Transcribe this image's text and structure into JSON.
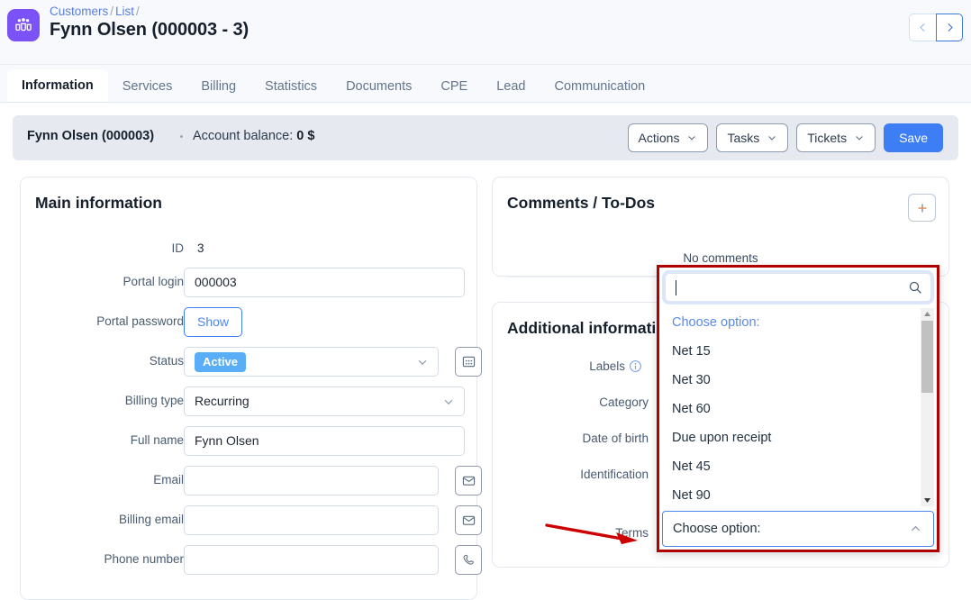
{
  "header": {
    "logo_icon": "people-group-icon",
    "breadcrumb": [
      "Customers",
      "List"
    ],
    "breadcrumb_sep": "/",
    "title": "Fynn Olsen (000003 - 3)",
    "nav_prev_icon": "chevron-left-icon",
    "nav_next_icon": "chevron-right-icon",
    "accent": "#7b52f5"
  },
  "tabs": [
    {
      "label": "Information",
      "active": true
    },
    {
      "label": "Services",
      "active": false
    },
    {
      "label": "Billing",
      "active": false
    },
    {
      "label": "Statistics",
      "active": false
    },
    {
      "label": "Documents",
      "active": false
    },
    {
      "label": "CPE",
      "active": false
    },
    {
      "label": "Lead",
      "active": false
    },
    {
      "label": "Communication",
      "active": false
    }
  ],
  "subbar": {
    "customer": "Fynn Olsen (000003)",
    "balance_label": "Account balance:",
    "balance_value": "0 $",
    "actions_label": "Actions",
    "tasks_label": "Tasks",
    "tickets_label": "Tickets",
    "save_label": "Save",
    "save_color": "#3d7ef5"
  },
  "main_card": {
    "title": "Main information",
    "fields": {
      "id_label": "ID",
      "id_value": "3",
      "portal_login_label": "Portal login",
      "portal_login_value": "000003",
      "portal_password_label": "Portal password",
      "show_label": "Show",
      "status_label": "Status",
      "status_value": "Active",
      "status_color": "#59aef7",
      "billing_type_label": "Billing type",
      "billing_type_value": "Recurring",
      "full_name_label": "Full name",
      "full_name_value": "Fynn Olsen",
      "email_label": "Email",
      "email_value": "",
      "billing_email_label": "Billing email",
      "billing_email_value": "",
      "phone_label": "Phone number",
      "phone_value": ""
    },
    "icons": {
      "status_picker": "grid-picker-icon",
      "email": "envelope-icon",
      "billing_email": "envelope-icon",
      "phone": "phone-icon",
      "chevron": "chevron-down-icon"
    }
  },
  "comments_card": {
    "title": "Comments / To-Dos",
    "add_icon": "plus-icon",
    "empty_text": "No comments"
  },
  "additional_card": {
    "title": "Additional information",
    "labels": {
      "labels": "Labels",
      "labels_info_icon": "info-icon",
      "category": "Category",
      "date_of_birth": "Date of birth",
      "identification": "Identification",
      "terms": "Terms"
    }
  },
  "terms_dropdown": {
    "highlight_color": "#b00000",
    "search_value": "",
    "search_icon": "search-icon",
    "placeholder_option": "Choose option:",
    "options": [
      "Net 15",
      "Net 30",
      "Net 60",
      "Due upon receipt",
      "Net 45",
      "Net 90"
    ],
    "control_label": "Choose option:",
    "control_icon": "chevron-up-icon",
    "scroll_up_icon": "triangle-up-icon",
    "scroll_down_icon": "triangle-down-icon"
  },
  "annotation": {
    "arrow_icon": "red-arrow-pointing-right",
    "arrow_color": "#cc0000"
  }
}
